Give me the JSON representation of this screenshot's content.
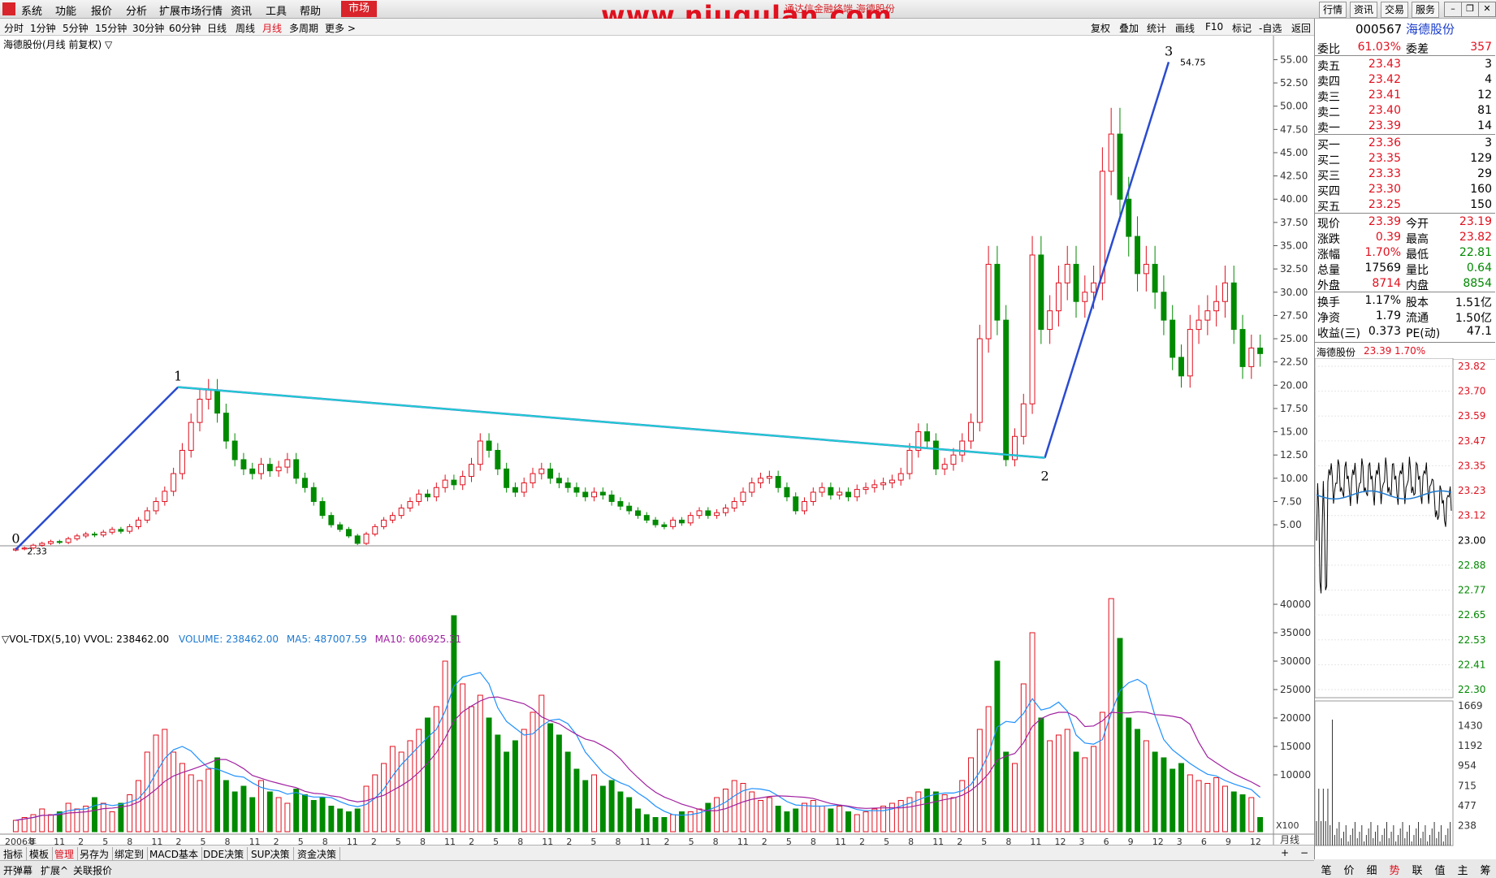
{
  "menu": {
    "items": [
      "系统",
      "功能",
      "报价",
      "分析",
      "扩展市场行情",
      "资讯",
      "工具",
      "帮助"
    ],
    "market_button": "市场",
    "watermark": "www.niugulan.com",
    "ticker_text": "通达信金融终端 海德股份",
    "right_buttons": [
      "行情",
      "资讯",
      "交易",
      "服务"
    ]
  },
  "period_bar": {
    "items": [
      "分时",
      "1分钟",
      "5分钟",
      "15分钟",
      "30分钟",
      "60分钟",
      "日线",
      "周线",
      "月线",
      "多周期",
      "更多 >"
    ],
    "active": "月线",
    "tools": [
      "复权",
      "叠加",
      "统计",
      "画线",
      "F10",
      "标记",
      "-自选",
      "返回"
    ]
  },
  "chart_header": {
    "title": "海德股份(月线 前复权) ▽"
  },
  "volume_header": {
    "label": "▽VOL-TDX(5,10) VVOL: 238462.00",
    "volume": "VOLUME: 238462.00",
    "ma5": "MA5: 487007.59",
    "ma10": "MA10: 606925.31"
  },
  "chart_data": {
    "type": "candlestick",
    "price_axis": [
      "55.00",
      "52.50",
      "50.00",
      "47.50",
      "45.00",
      "42.50",
      "40.00",
      "37.50",
      "35.00",
      "32.50",
      "30.00",
      "27.50",
      "25.00",
      "22.50",
      "20.00",
      "17.50",
      "15.00",
      "12.50",
      "10.00",
      "7.50",
      "5.00"
    ],
    "volume_axis": [
      "40000",
      "35000",
      "30000",
      "25000",
      "20000",
      "15000",
      "10000"
    ],
    "volume_multiplier": "X100",
    "x_labels": [
      "2006年",
      "8",
      "11",
      "2",
      "5",
      "8",
      "11",
      "2",
      "5",
      "8",
      "11",
      "2",
      "5",
      "8",
      "11",
      "2",
      "5",
      "8",
      "11",
      "2",
      "5",
      "8",
      "11",
      "2",
      "5",
      "8",
      "11",
      "2",
      "5",
      "8",
      "11",
      "2",
      "5",
      "8",
      "11",
      "2",
      "5",
      "8",
      "11",
      "2",
      "5",
      "8",
      "11",
      "12",
      "3",
      "6",
      "9",
      "12",
      "3",
      "6",
      "9",
      "12"
    ],
    "period_label": "月线",
    "price_ylim": [
      3.0,
      56.0
    ],
    "volume_ylim": [
      0,
      45000
    ],
    "wave_labels": [
      "0",
      "1",
      "2",
      "3"
    ],
    "annotations": {
      "high": "54.75",
      "low": "2.33"
    },
    "wave_points": [
      {
        "label": "0",
        "t": 0,
        "price": 2.33
      },
      {
        "label": "1",
        "t": 38,
        "price": 19.8
      },
      {
        "label": "2",
        "t": 241,
        "price": 12.2
      },
      {
        "label": "3",
        "t": 270,
        "price": 54.75
      }
    ],
    "closes": [
      2.4,
      2.5,
      2.8,
      3.0,
      3.2,
      3.1,
      3.5,
      3.8,
      4.0,
      3.9,
      4.2,
      4.5,
      4.3,
      4.8,
      5.5,
      6.5,
      7.5,
      8.6,
      10.5,
      13.0,
      16.0,
      18.5,
      19.5,
      17.0,
      14.0,
      12.0,
      11.0,
      10.5,
      11.5,
      10.8,
      11.2,
      12.0,
      10.0,
      9.0,
      7.5,
      6.0,
      5.0,
      4.5,
      3.8,
      3.0,
      4.0,
      4.8,
      5.5,
      6.0,
      6.8,
      7.5,
      8.3,
      8.0,
      9.0,
      9.8,
      9.3,
      10.2,
      11.5,
      14.0,
      13.0,
      11.0,
      9.0,
      8.5,
      9.5,
      10.5,
      11.0,
      10.0,
      9.5,
      9.0,
      8.5,
      8.0,
      8.5,
      8.2,
      7.5,
      7.0,
      6.5,
      6.0,
      5.5,
      5.0,
      4.8,
      5.5,
      5.2,
      6.0,
      6.5,
      6.0,
      6.3,
      6.8,
      7.5,
      8.5,
      9.5,
      10.0,
      10.2,
      9.0,
      8.0,
      6.5,
      7.5,
      8.5,
      9.0,
      8.2,
      8.5,
      8.0,
      8.8,
      9.0,
      9.3,
      9.5,
      9.8,
      10.5,
      13.0,
      15.0,
      14.0,
      11.0,
      11.5,
      12.5,
      14.0,
      16.0,
      25.0,
      33.0,
      27.0,
      12.0,
      14.5,
      18.0,
      34.0,
      26.0,
      28.0,
      31.0,
      33.0,
      29.0,
      30.0,
      31.0,
      43.0,
      47.0,
      40.0,
      36.0,
      32.0,
      33.0,
      30.0,
      27.0,
      23.0,
      21.0,
      26.0,
      27.0,
      28.0,
      29.0,
      31.0,
      26.0,
      22.0,
      24.0,
      23.4
    ],
    "volumes": [
      2000,
      2500,
      3000,
      4000,
      3000,
      3500,
      5000,
      4000,
      4500,
      6000,
      5000,
      3500,
      5000,
      6500,
      9000,
      14000,
      17000,
      18000,
      14000,
      12000,
      10000,
      9000,
      11000,
      13000,
      9000,
      7000,
      8000,
      6000,
      9000,
      7000,
      6000,
      5000,
      7500,
      6500,
      5500,
      6000,
      4500,
      4000,
      3500,
      4000,
      8000,
      10000,
      12000,
      15000,
      14000,
      16000,
      18000,
      20000,
      22000,
      30000,
      38000,
      26000,
      22000,
      24000,
      20000,
      17000,
      14000,
      16000,
      18000,
      21000,
      24000,
      19000,
      17000,
      14000,
      11000,
      9000,
      10000,
      8000,
      9000,
      7000,
      6000,
      4000,
      3000,
      2500,
      2500,
      3000,
      3500,
      3500,
      4000,
      5000,
      6000,
      7500,
      9000,
      8500,
      7000,
      5500,
      6000,
      4500,
      3500,
      4000,
      5000,
      5500,
      4500,
      4000,
      4500,
      3500,
      3000,
      3500,
      4000,
      4500,
      5000,
      5500,
      6000,
      7000,
      7500,
      7000,
      6500,
      6000,
      9000,
      13000,
      18000,
      22000,
      30000,
      14000,
      12000,
      26000,
      35000,
      20000,
      16000,
      17000,
      18000,
      14000,
      13000,
      15000,
      21000,
      41000,
      34000,
      20000,
      18000,
      16000,
      14000,
      13000,
      11000,
      12000,
      10000,
      9000,
      8500,
      9500,
      8000,
      7000,
      6500,
      6000,
      2500
    ]
  },
  "quote": {
    "code": "000567",
    "name": "海德股份",
    "weibi_label": "委比",
    "weibi": "61.03%",
    "weicha_label": "委差",
    "weicha": "357",
    "asks": [
      {
        "label": "卖五",
        "price": "23.43",
        "vol": "3"
      },
      {
        "label": "卖四",
        "price": "23.42",
        "vol": "4"
      },
      {
        "label": "卖三",
        "price": "23.41",
        "vol": "12"
      },
      {
        "label": "卖二",
        "price": "23.40",
        "vol": "81"
      },
      {
        "label": "卖一",
        "price": "23.39",
        "vol": "14"
      }
    ],
    "bids": [
      {
        "label": "买一",
        "price": "23.36",
        "vol": "3"
      },
      {
        "label": "买二",
        "price": "23.35",
        "vol": "129"
      },
      {
        "label": "买三",
        "price": "23.33",
        "vol": "29"
      },
      {
        "label": "买四",
        "price": "23.30",
        "vol": "160"
      },
      {
        "label": "买五",
        "price": "23.25",
        "vol": "150"
      }
    ],
    "stats": [
      {
        "l1": "现价",
        "v1": "23.39",
        "c1": "red",
        "l2": "今开",
        "v2": "23.19",
        "c2": "red"
      },
      {
        "l1": "涨跌",
        "v1": "0.39",
        "c1": "red",
        "l2": "最高",
        "v2": "23.82",
        "c2": "red"
      },
      {
        "l1": "涨幅",
        "v1": "1.70%",
        "c1": "red",
        "l2": "最低",
        "v2": "22.81",
        "c2": "green"
      },
      {
        "l1": "总量",
        "v1": "17569",
        "c1": "black",
        "l2": "量比",
        "v2": "0.64",
        "c2": "green"
      },
      {
        "l1": "外盘",
        "v1": "8714",
        "c1": "red",
        "l2": "内盘",
        "v2": "8854",
        "c2": "green"
      }
    ],
    "stats2": [
      {
        "l1": "换手",
        "v1": "1.17%",
        "l2": "股本",
        "v2": "1.51亿"
      },
      {
        "l1": "净资",
        "v1": "1.79",
        "l2": "流通",
        "v2": "1.50亿"
      },
      {
        "l1": "收益(三)",
        "v1": "0.373",
        "l2": "PE(动)",
        "v2": "47.1"
      }
    ],
    "mini_title": "海德股份",
    "mini_price": "23.39",
    "mini_pct": "1.70%",
    "mini_axis": [
      "23.82",
      "23.70",
      "23.59",
      "23.47",
      "23.35",
      "23.23",
      "23.12",
      "23.00",
      "22.88",
      "22.77",
      "22.65",
      "22.53",
      "22.41",
      "22.30"
    ],
    "mini_vol_axis": [
      "1669",
      "1430",
      "1192",
      "954",
      "715",
      "477",
      "238"
    ]
  },
  "bottom_tabs": [
    "指标",
    "模板",
    "管理",
    "另存为",
    "绑定到",
    "MACD基本",
    "DDE决策",
    "SUP决策",
    "资金决策"
  ],
  "bottom_tabs_active": "管理",
  "status_items": [
    "开弹幕",
    "扩展^",
    "关联报价"
  ],
  "mini_tabs": [
    "笔",
    "价",
    "细",
    "势",
    "联",
    "值",
    "主",
    "筹"
  ],
  "mini_tabs_active": "势",
  "colors": {
    "up": "#e0101e",
    "down": "#008a00",
    "ma5": "#1e90ff",
    "ma10": "#a020a0",
    "wave": "#2a4bd0",
    "magenta": "#e020e0",
    "cyan": "#20d0d0"
  }
}
